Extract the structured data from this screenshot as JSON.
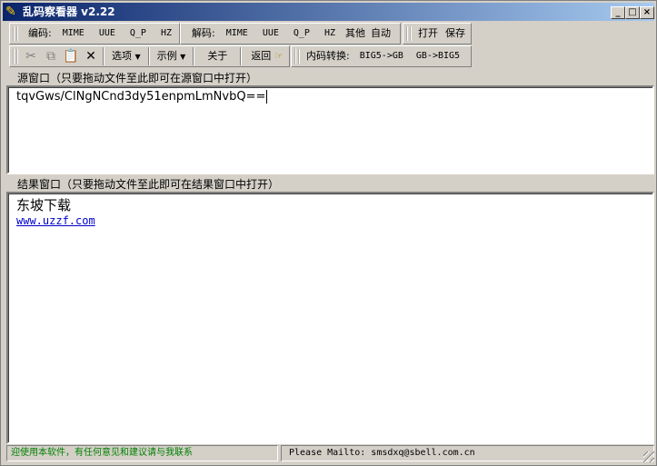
{
  "window": {
    "title": "乱码察看器  v2.22",
    "minimize": "_",
    "maximize": "□",
    "close": "×"
  },
  "toolbar1": {
    "encode_label": "编码:",
    "encode": [
      "MIME",
      "UUE",
      "Q_P",
      "HZ"
    ],
    "decode_label": "解码:",
    "decode": [
      "MIME",
      "UUE",
      "Q_P",
      "HZ",
      "其他",
      "自动"
    ],
    "open": "打开",
    "save": "保存"
  },
  "toolbar2": {
    "options": "选项",
    "examples": "示例",
    "about": "关于",
    "back": "返回",
    "convert_label": "内码转换:",
    "big5_to_gb": "BIG5->GB",
    "gb_to_big5": "GB->BIG5"
  },
  "source": {
    "label": "源窗口（只要拖动文件至此即可在源窗口中打开）",
    "value": "tqvGws/ClNgNCnd3dy51enpmLmNvbQ=="
  },
  "result": {
    "label": "结果窗口（只要拖动文件至此即可在结果窗口中打开）",
    "line1": "东坡下载",
    "link": "www.uzzf.com"
  },
  "status": {
    "left": "迎使用本软件，有任何意见和建议请与我联系",
    "right": "Please Mailto: smsdxq@sbell.com.cn"
  }
}
